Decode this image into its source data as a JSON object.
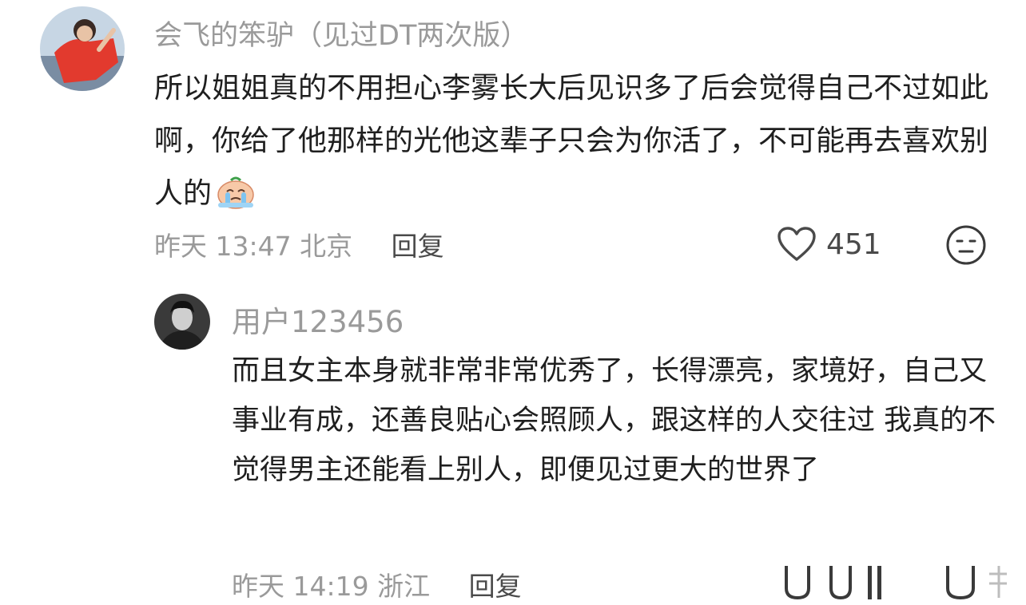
{
  "comments": [
    {
      "username": "会飞的笨驴（见过DT两次版）",
      "text": "所以姐姐真的不用担心李雾长大后见识多了后会觉得自己不过如此啊，你给了他那样的光他这辈子只会为你活了，不可能再去喜欢别人的",
      "emoji": "crying-emoji",
      "time": "昨天 13:47",
      "location": "北京",
      "reply_label": "回复",
      "like_count": "451",
      "like_icon": "heart-outline-icon",
      "extra_icon": "neutral-face-icon"
    },
    {
      "username": "用户123456",
      "text": "而且女主本身就非常非常优秀了，长得漂亮，家境好，自己又事业有成，还善良贴心会照顾人，跟这样的人交往过 我真的不觉得男主还能看上别人，即便见过更大的世界了",
      "time": "昨天 14:19",
      "location": "浙江",
      "reply_label": "回复"
    }
  ],
  "colors": {
    "primary_text": "#1f1f1f",
    "secondary_text": "#9a9a9a",
    "action_text": "#4a4a4a",
    "avatar1_bg": "#e23a2e",
    "avatar2_bg": "#3a3a3a"
  }
}
